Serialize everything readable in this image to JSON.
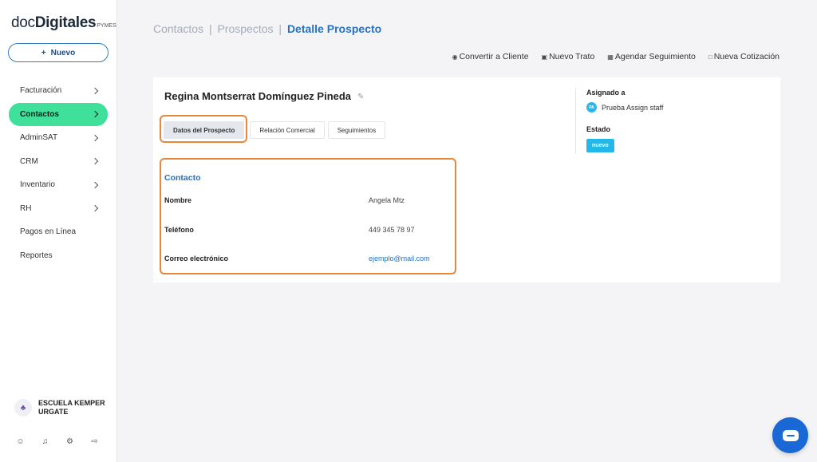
{
  "app": {
    "logo_part1": "doc",
    "logo_part2": "Digitales",
    "logo_suffix": "PYMES",
    "new_button_icon": "+",
    "new_button_label": "Nuevo"
  },
  "sidebar": {
    "items": [
      {
        "label": "Facturación",
        "has_chevron": true
      },
      {
        "label": "Contactos",
        "has_chevron": true,
        "active": true
      },
      {
        "label": "AdminSAT",
        "has_chevron": true
      },
      {
        "label": "CRM",
        "has_chevron": true
      },
      {
        "label": "Inventario",
        "has_chevron": true
      },
      {
        "label": "RH",
        "has_chevron": true
      },
      {
        "label": "Pagos en Línea",
        "has_chevron": false
      },
      {
        "label": "Reportes",
        "has_chevron": false
      }
    ],
    "org_name": "ESCUELA KEMPER URGATE",
    "bottom_icons": [
      "user-icon",
      "bell-icon",
      "gear-icon",
      "logout-icon"
    ]
  },
  "breadcrumb": {
    "items": [
      "Contactos",
      "Prospectos"
    ],
    "separator": "|",
    "current": "Detalle Prospecto"
  },
  "actions": [
    {
      "icon": "convert-icon",
      "label": "Convertir a Cliente"
    },
    {
      "icon": "briefcase-icon",
      "label": "Nuevo Trato"
    },
    {
      "icon": "calendar-icon",
      "label": "Agendar Seguimiento"
    },
    {
      "icon": "document-icon",
      "label": "Nueva Cotización"
    }
  ],
  "prospect": {
    "name": "Regina Montserrat Domínguez Pineda",
    "tabs": [
      "Datos del Prospecto",
      "Relación Comercial",
      "Seguimientos"
    ],
    "active_tab": "Datos del Prospecto",
    "section_title": "Contacto",
    "fields": [
      {
        "label": "Nombre",
        "value": "Angela Mtz"
      },
      {
        "label": "Teléfono",
        "value": "449 345 78 97"
      },
      {
        "label": "Correo electrónico",
        "value": "ejemplo@mail.com"
      }
    ]
  },
  "assignment": {
    "assigned_label": "Asignado a",
    "assignee_initials": "PA",
    "assignee_name": "Prueba Assign staff",
    "status_label": "Estado",
    "status_value": "nuevo"
  },
  "colors": {
    "accent_blue": "#2672c2",
    "active_nav": "#3ee09a",
    "highlight": "#e8873a",
    "status_badge": "#22b8ea",
    "chat_button": "#1a68d6"
  }
}
